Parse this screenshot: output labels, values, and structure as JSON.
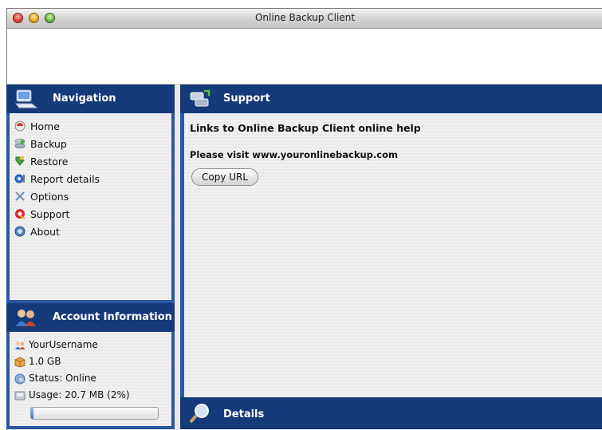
{
  "window": {
    "title": "Online Backup Client"
  },
  "navigation": {
    "title": "Navigation",
    "items": [
      {
        "label": "Home",
        "icon": "home-icon"
      },
      {
        "label": "Backup",
        "icon": "backup-icon"
      },
      {
        "label": "Restore",
        "icon": "restore-icon"
      },
      {
        "label": "Report details",
        "icon": "report-icon"
      },
      {
        "label": "Options",
        "icon": "options-icon"
      },
      {
        "label": "Support",
        "icon": "support-icon"
      },
      {
        "label": "About",
        "icon": "about-icon"
      }
    ]
  },
  "account": {
    "title": "Account Information",
    "username": "YourUsername",
    "quota": "1.0 GB",
    "status": "Status: Online",
    "usage": "Usage: 20.7 MB (2%)",
    "usage_fraction": 0.02
  },
  "support": {
    "title": "Support",
    "heading": "Links to Online Backup Client online help",
    "visit_text": "Please visit www.youronlinebackup.com",
    "copy_button": "Copy URL"
  },
  "details": {
    "title": "Details"
  },
  "colors": {
    "header_bg": "#153a7a",
    "frame_blue": "#2a57a3"
  }
}
